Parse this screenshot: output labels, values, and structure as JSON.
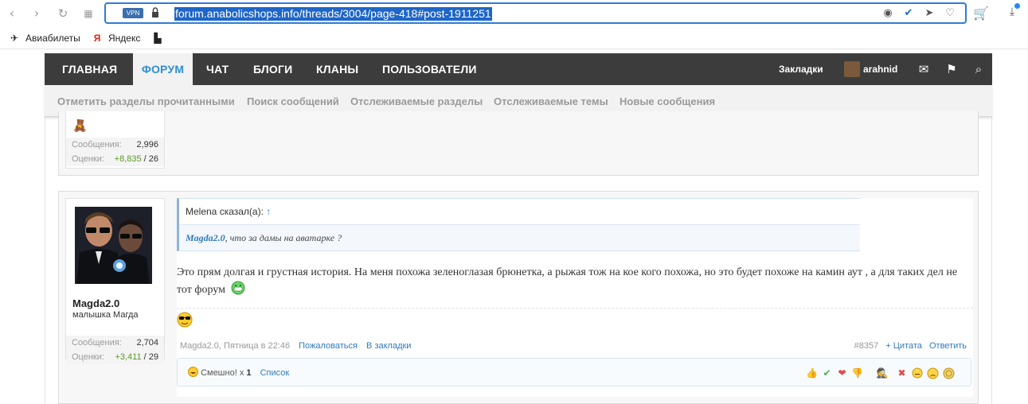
{
  "browser": {
    "url": "forum.anabolicshops.info/threads/3004/page-418#post-1911251",
    "vpn_label": "VPN",
    "bookmarks": [
      {
        "label": "Авиабилеты",
        "icon": "plane-icon"
      },
      {
        "label": "Яндекс",
        "icon": "yandex-icon"
      },
      {
        "label": "",
        "icon": "document-icon"
      }
    ]
  },
  "topnav": {
    "items": [
      {
        "label": "ГЛАВНАЯ"
      },
      {
        "label": "ФОРУМ"
      },
      {
        "label": "ЧАТ"
      },
      {
        "label": "БЛОГИ"
      },
      {
        "label": "КЛАНЫ"
      },
      {
        "label": "ПОЛЬЗОВАТЕЛИ"
      }
    ],
    "bookmarks_label": "Закладки",
    "username": "arahnid"
  },
  "subnav": {
    "items": [
      {
        "label": "Отметить разделы прочитанными"
      },
      {
        "label": "Поиск сообщений"
      },
      {
        "label": "Отслеживаемые разделы"
      },
      {
        "label": "Отслеживаемые темы"
      },
      {
        "label": "Новые сообщения"
      }
    ]
  },
  "post1": {
    "stats": [
      {
        "key": "Сообщения:",
        "value": "2,996"
      },
      {
        "key": "Оценки:",
        "pos": "+8,835",
        "rest": " / 26"
      }
    ]
  },
  "post2": {
    "username": "Magda2.0",
    "user_title": "малышка Магда",
    "stats": [
      {
        "key": "Сообщения:",
        "value": "2,704"
      },
      {
        "key": "Оценки:",
        "pos": "+3,411",
        "rest": " / 29"
      }
    ],
    "quote": {
      "author_line": "Melena сказал(а):",
      "arrow": "↑",
      "who": "Magda2.0",
      "text": ", что за дамы на аватарке ?"
    },
    "message": "Это прям долгая и грустная история. На меня похожа зеленоглазая брюнетка, а рыжая тож на кое кого похожа, но это будет похоже на камин аут , а для таких дел не тот форум",
    "meta": {
      "author_time": "Magda2.0, Пятница в 22:46",
      "report": "Пожаловаться",
      "bookmark": "В закладки",
      "post_num": "#8357",
      "quote": "+ Цитата",
      "reply": "Ответить"
    },
    "likes": {
      "label": "Смешно!",
      "times": "x",
      "count": "1",
      "list": "Список"
    }
  },
  "colors": {
    "nav_bg": "#3c3c3c",
    "accent": "#2f8ed3",
    "link": "#2f7bc0"
  }
}
